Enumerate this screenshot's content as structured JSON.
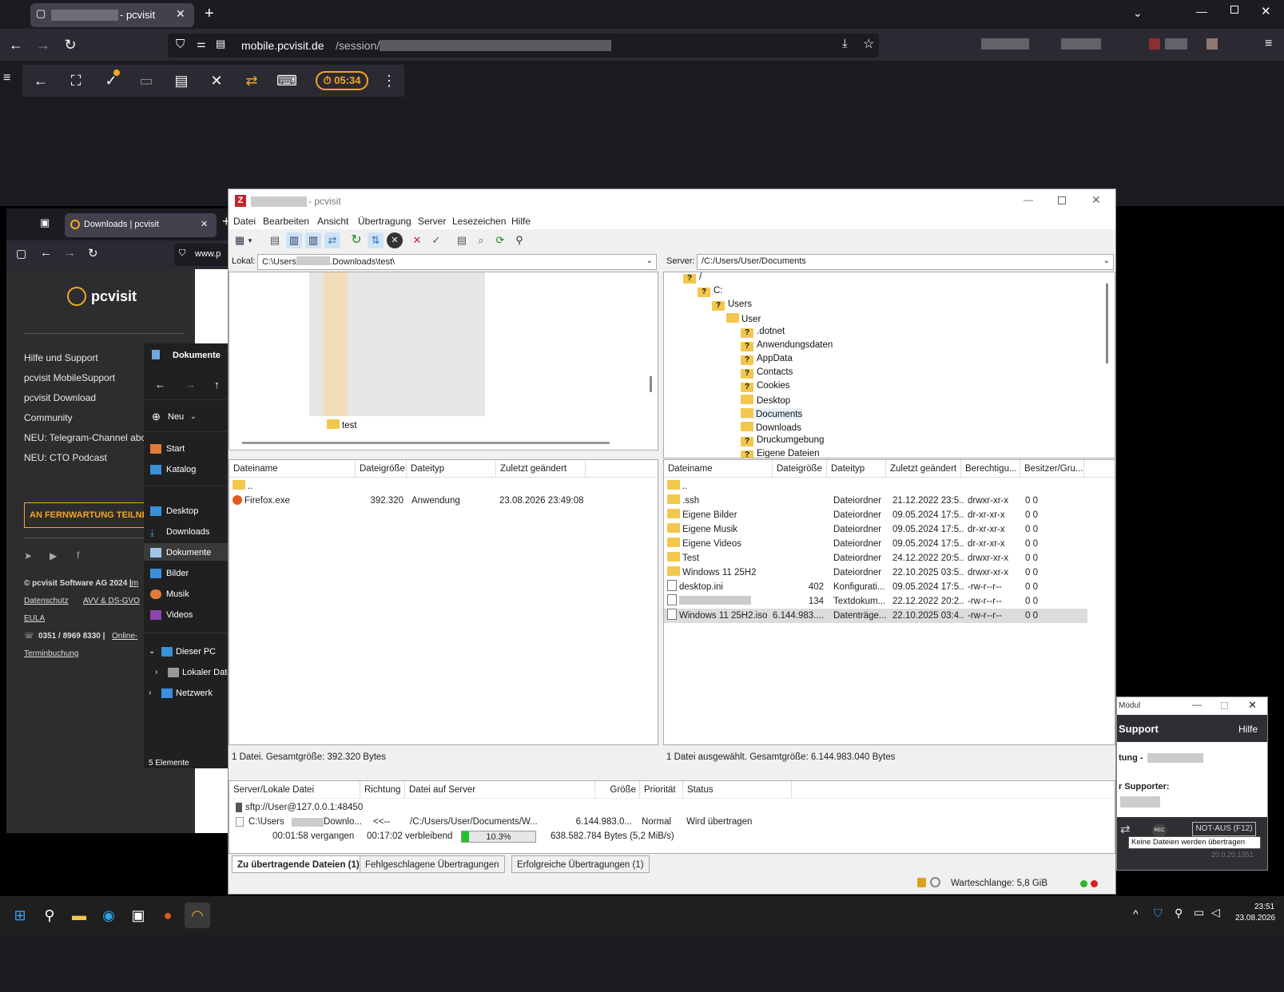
{
  "browser": {
    "tab_title": "- pcvisit",
    "url_domain": "mobile.pcvisit.de",
    "url_path": "/session/"
  },
  "remote_toolbar": {
    "timer": "05:34"
  },
  "left_browser": {
    "tab_title": "Downloads | pcvisit",
    "url_partial": "www.p",
    "logo_text": "pcvisit",
    "links": [
      "Hilfe und Support",
      "pcvisit MobileSupport",
      "pcvisit Download",
      "Community",
      "NEU: Telegram-Channel abon",
      "NEU: CTO Podcast"
    ],
    "cta": "AN FERNWARTUNG TEILNEH",
    "footer": {
      "copyright": "© pcvisit Software AG 2024 |",
      "imprint": "Im",
      "privacy": "Datenschutz",
      "avv": "AVV & DS-GVO",
      "eula": "EULA",
      "phone": "0351 / 8969 8330 |",
      "online": "Online-",
      "terminbuchung": "Terminbuchung"
    }
  },
  "explorer": {
    "title": "Dokumente",
    "new_label": "Neu",
    "nav_items": [
      "Start",
      "Katalog",
      "Desktop",
      "Downloads",
      "Dokumente",
      "Bilder",
      "Musik",
      "Videos",
      "Dieser PC",
      "Lokaler Date",
      "Netzwerk"
    ],
    "status": "5 Elemente"
  },
  "filezilla": {
    "title": "- pcvisit",
    "menu": [
      "Datei",
      "Bearbeiten",
      "Ansicht",
      "Übertragung",
      "Server",
      "Lesezeichen",
      "Hilfe"
    ],
    "local": {
      "label": "Lokal:",
      "path_start": "C:\\Users",
      "path_end": ".Downloads\\test\\",
      "tree_leaf": "test",
      "columns": [
        "Dateiname",
        "Dateigröße",
        "Dateityp",
        "Zuletzt geändert"
      ],
      "files": [
        {
          "name": "..",
          "size": "",
          "type": "",
          "modified": ""
        },
        {
          "name": "Firefox.exe",
          "size": "392.320",
          "type": "Anwendung",
          "modified": "23.08.2026 23:49:08"
        }
      ],
      "status": "1 Datei. Gesamtgröße: 392.320 Bytes"
    },
    "remote": {
      "label": "Server:",
      "path": "/C:/Users/User/Documents",
      "tree": [
        "/",
        "C:",
        "Users",
        "User",
        ".dotnet",
        "Anwendungsdaten",
        "AppData",
        "Contacts",
        "Cookies",
        "Desktop",
        "Documents",
        "Downloads",
        "Druckumgebung",
        "Eigene Dateien"
      ],
      "columns": [
        "Dateiname",
        "Dateigröße",
        "Dateityp",
        "Zuletzt geändert",
        "Berechtigu...",
        "Besitzer/Gru..."
      ],
      "files": [
        {
          "name": "..",
          "size": "",
          "type": "",
          "modified": "",
          "perm": "",
          "owner": ""
        },
        {
          "name": ".ssh",
          "size": "",
          "type": "Dateiordner",
          "modified": "21.12.2022 23:5...",
          "perm": "drwxr-xr-x",
          "owner": "0 0"
        },
        {
          "name": "Eigene Bilder",
          "size": "",
          "type": "Dateiordner",
          "modified": "09.05.2024 17:5...",
          "perm": "dr-xr-xr-x",
          "owner": "0 0"
        },
        {
          "name": "Eigene Musik",
          "size": "",
          "type": "Dateiordner",
          "modified": "09.05.2024 17:5...",
          "perm": "dr-xr-xr-x",
          "owner": "0 0"
        },
        {
          "name": "Eigene Videos",
          "size": "",
          "type": "Dateiordner",
          "modified": "09.05.2024 17:5...",
          "perm": "dr-xr-xr-x",
          "owner": "0 0"
        },
        {
          "name": "Test",
          "size": "",
          "type": "Dateiordner",
          "modified": "24.12.2022 20:5...",
          "perm": "drwxr-xr-x",
          "owner": "0 0"
        },
        {
          "name": "Windows 11 25H2",
          "size": "",
          "type": "Dateiordner",
          "modified": "22.10.2025 03:5...",
          "perm": "drwxr-xr-x",
          "owner": "0 0"
        },
        {
          "name": "desktop.ini",
          "size": "402",
          "type": "Konfigurati...",
          "modified": "09.05.2024 17:5...",
          "perm": "-rw-r--r--",
          "owner": "0 0"
        },
        {
          "name": "",
          "size": "134",
          "type": "Textdokum...",
          "modified": "22.12.2022 20:2...",
          "perm": "-rw-r--r--",
          "owner": "0 0"
        },
        {
          "name": "Windows 11 25H2.iso",
          "size": "6.144.983....",
          "type": "Datenträge...",
          "modified": "22.10.2025 03:4...",
          "perm": "-rw-r--r--",
          "owner": "0 0"
        }
      ],
      "status": "1 Datei ausgewählt. Gesamtgröße: 6.144.983.040 Bytes"
    },
    "queue": {
      "columns": [
        "Server/Lokale Datei",
        "Richtung",
        "Datei auf Server",
        "Größe",
        "Priorität",
        "Status"
      ],
      "server": "sftp://User@127.0.0.1:48450",
      "local_file_a": "C:\\Users",
      "local_file_b": "Downlo...",
      "direction": "<<--",
      "remote_file": "/C:/Users/User/Documents/W...",
      "size": "6.144.983.0...",
      "priority": "Normal",
      "status": "Wird übertragen",
      "elapsed": "00:01:58 vergangen",
      "remaining": "00:17:02 verbleibend",
      "progress_text": "10.3%",
      "progress": 0.103,
      "bytes": "638.582.784 Bytes (5,2 MiB/s)"
    },
    "queue_tabs": [
      "Zu übertragende Dateien (1)",
      "Fehlgeschlagene Übertragungen",
      "Erfolgreiche Übertragungen (1)"
    ],
    "statusbar": "Warteschlange: 5,8 GiB"
  },
  "support_window": {
    "title": "Modul",
    "header": "Support",
    "help": "Hilfe",
    "line1": "tung -",
    "line2": "r Supporter:",
    "rec": "REC",
    "not_aus": "NOT-AUS (F12)",
    "tooltip": "Keine Dateien werden übertragen",
    "partial": "20.0.20.1351"
  },
  "taskbar": {
    "time": "23:51",
    "date": "23.08.2026"
  },
  "colors": {
    "accent": "#f5a623",
    "progress": "#22c02a"
  }
}
